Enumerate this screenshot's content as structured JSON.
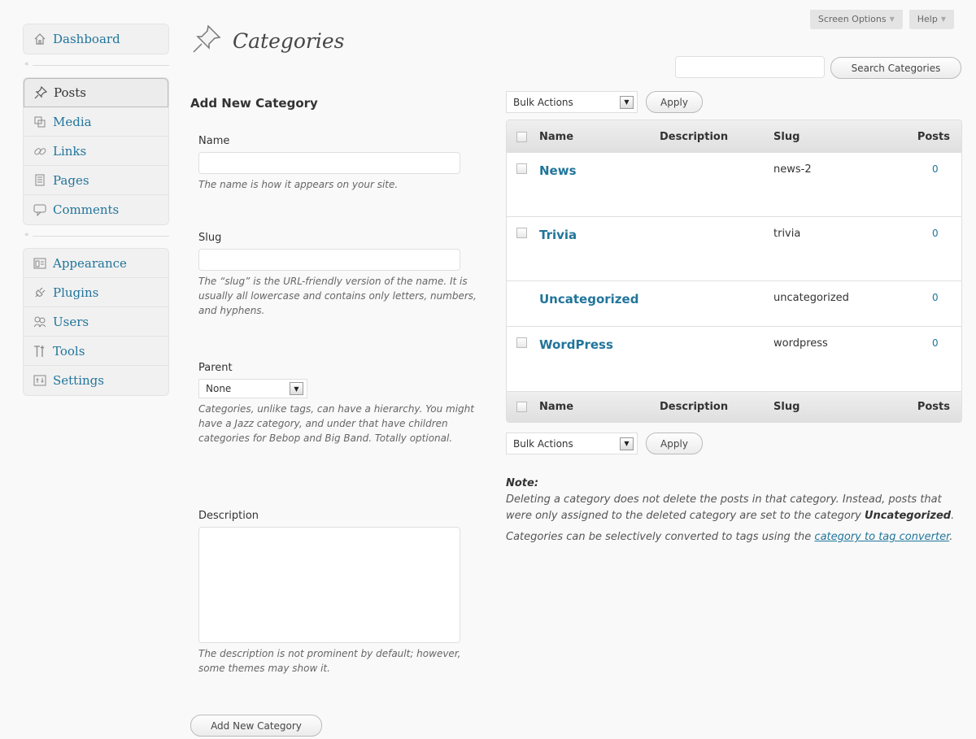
{
  "screen_meta": {
    "screen_options": "Screen Options",
    "help": "Help"
  },
  "menu": {
    "group1": [
      {
        "label": "Dashboard",
        "icon": "house-icon"
      }
    ],
    "group2": [
      {
        "label": "Posts",
        "icon": "pushpin-icon",
        "current": true
      },
      {
        "label": "Media",
        "icon": "media-icon"
      },
      {
        "label": "Links",
        "icon": "chain-link-icon"
      },
      {
        "label": "Pages",
        "icon": "pages-icon"
      },
      {
        "label": "Comments",
        "icon": "speech-bubble-icon"
      }
    ],
    "group3": [
      {
        "label": "Appearance",
        "icon": "appearance-icon"
      },
      {
        "label": "Plugins",
        "icon": "plug-icon"
      },
      {
        "label": "Users",
        "icon": "users-icon"
      },
      {
        "label": "Tools",
        "icon": "tools-icon"
      },
      {
        "label": "Settings",
        "icon": "settings-icon"
      }
    ]
  },
  "page": {
    "title": "Categories"
  },
  "search": {
    "button": "Search Categories",
    "value": ""
  },
  "form": {
    "heading": "Add New Category",
    "name_label": "Name",
    "name_hint": "The name is how it appears on your site.",
    "slug_label": "Slug",
    "slug_hint": "The “slug” is the URL-friendly version of the name. It is usually all lowercase and contains only letters, numbers, and hyphens.",
    "parent_label": "Parent",
    "parent_value": "None",
    "parent_hint": "Categories, unlike tags, can have a hierarchy. You might have a Jazz category, and under that have children categories for Bebop and Big Band. Totally optional.",
    "desc_label": "Description",
    "desc_hint": "The description is not prominent by default; however, some themes may show it.",
    "submit": "Add New Category"
  },
  "bulk": {
    "select": "Bulk Actions",
    "apply": "Apply"
  },
  "table": {
    "columns": {
      "name": "Name",
      "description": "Description",
      "slug": "Slug",
      "posts": "Posts"
    },
    "rows": [
      {
        "name": "News",
        "description": "",
        "slug": "news-2",
        "posts": "0"
      },
      {
        "name": "Trivia",
        "description": "",
        "slug": "trivia",
        "posts": "0"
      },
      {
        "name": "Uncategorized",
        "description": "",
        "slug": "uncategorized",
        "posts": "0"
      },
      {
        "name": "WordPress",
        "description": "",
        "slug": "wordpress",
        "posts": "0"
      }
    ]
  },
  "note": {
    "title": "Note:",
    "p1_a": "Deleting a category does not delete the posts in that category. Instead, posts that were only assigned to the deleted category are set to the category ",
    "p1_b": "Uncategorized",
    "p1_c": ".",
    "p2_a": "Categories can be selectively converted to tags using the ",
    "p2_link": "category to tag converter",
    "p2_c": "."
  }
}
